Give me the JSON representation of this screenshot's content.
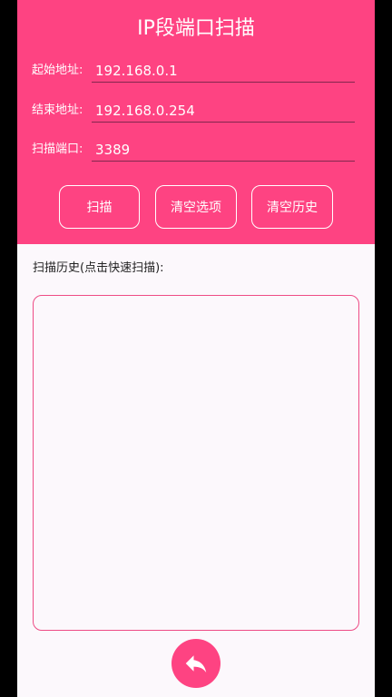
{
  "header": {
    "title": "IP段端口扫描"
  },
  "form": {
    "start": {
      "label": "起始地址:",
      "value": "192.168.0.1"
    },
    "end": {
      "label": "结束地址:",
      "value": "192.168.0.254"
    },
    "port": {
      "label": "扫描端口:",
      "value": "3389"
    }
  },
  "buttons": {
    "scan": "扫描",
    "clear_options": "清空选项",
    "clear_history": "清空历史"
  },
  "history": {
    "label": "扫描历史(点击快速扫描):",
    "items": []
  },
  "icons": {
    "back": "reply-arrow-icon"
  },
  "colors": {
    "accent": "#fe4382",
    "background": "#fcf8fc",
    "history_border": "#ee4c86"
  }
}
